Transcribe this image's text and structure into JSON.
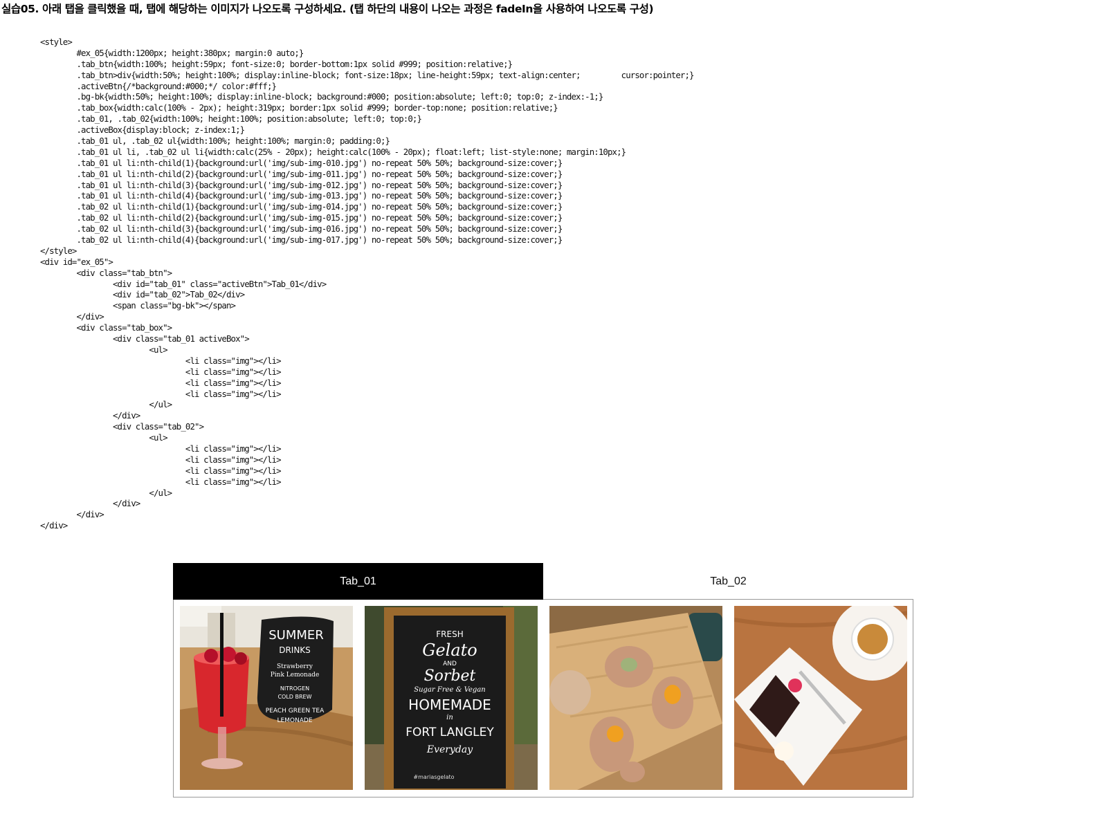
{
  "heading": "실습05. 아래 탭을 클릭했을 때, 탭에 해당하는 이미지가 나오도록 구성하세요. (탭 하단의 내용이 나오는 과정은 fadeIn을 사용하여 나오도록 구성)",
  "code_lines": [
    "<style>",
    "        #ex_05{width:1200px; height:380px; margin:0 auto;}",
    "        .tab_btn{width:100%; height:59px; font-size:0; border-bottom:1px solid #999; position:relative;}",
    "        .tab_btn>div{width:50%; height:100%; display:inline-block; font-size:18px; line-height:59px; text-align:center;         cursor:pointer;}",
    "        .activeBtn{/*background:#000;*/ color:#fff;}",
    "        .bg-bk{width:50%; height:100%; display:inline-block; background:#000; position:absolute; left:0; top:0; z-index:-1;}",
    "        .tab_box{width:calc(100% - 2px); height:319px; border:1px solid #999; border-top:none; position:relative;}",
    "        .tab_01, .tab_02{width:100%; height:100%; position:absolute; left:0; top:0;}",
    "        .activeBox{display:block; z-index:1;}",
    "        .tab_01 ul, .tab_02 ul{width:100%; height:100%; margin:0; padding:0;}",
    "        .tab_01 ul li, .tab_02 ul li{width:calc(25% - 20px); height:calc(100% - 20px); float:left; list-style:none; margin:10px;}",
    "        .tab_01 ul li:nth-child(1){background:url('img/sub-img-010.jpg') no-repeat 50% 50%; background-size:cover;}",
    "        .tab_01 ul li:nth-child(2){background:url('img/sub-img-011.jpg') no-repeat 50% 50%; background-size:cover;}",
    "        .tab_01 ul li:nth-child(3){background:url('img/sub-img-012.jpg') no-repeat 50% 50%; background-size:cover;}",
    "        .tab_01 ul li:nth-child(4){background:url('img/sub-img-013.jpg') no-repeat 50% 50%; background-size:cover;}",
    "        .tab_02 ul li:nth-child(1){background:url('img/sub-img-014.jpg') no-repeat 50% 50%; background-size:cover;}",
    "        .tab_02 ul li:nth-child(2){background:url('img/sub-img-015.jpg') no-repeat 50% 50%; background-size:cover;}",
    "        .tab_02 ul li:nth-child(3){background:url('img/sub-img-016.jpg') no-repeat 50% 50%; background-size:cover;}",
    "        .tab_02 ul li:nth-child(4){background:url('img/sub-img-017.jpg') no-repeat 50% 50%; background-size:cover;}",
    "</style>",
    "<div id=\"ex_05\">",
    "        <div class=\"tab_btn\">",
    "                <div id=\"tab_01\" class=\"activeBtn\">Tab_01</div>",
    "                <div id=\"tab_02\">Tab_02</div>",
    "                <span class=\"bg-bk\"></span>",
    "        </div>",
    "        <div class=\"tab_box\">",
    "                <div class=\"tab_01 activeBox\">",
    "                        <ul>",
    "                                <li class=\"img\"></li>",
    "                                <li class=\"img\"></li>",
    "                                <li class=\"img\"></li>",
    "                                <li class=\"img\"></li>",
    "                        </ul>",
    "                </div>",
    "                <div class=\"tab_02\">",
    "                        <ul>",
    "                                <li class=\"img\"></li>",
    "                                <li class=\"img\"></li>",
    "                                <li class=\"img\"></li>",
    "                                <li class=\"img\"></li>",
    "                        </ul>",
    "                </div>",
    "        </div>",
    "</div>"
  ],
  "tabs": [
    {
      "label": "Tab_01",
      "active": true
    },
    {
      "label": "Tab_02",
      "active": false
    }
  ],
  "active_tab_bg": "#000000",
  "border_color": "#999999",
  "images": [
    {
      "name": "summer-drinks-photo",
      "sign_lines": [
        "SUMMER",
        "DRINKS",
        "Strawberry",
        "Pink Lemonade",
        "NITROGEN",
        "COLD BREW",
        "PEACH GREEN TEA",
        "LEMONADE"
      ]
    },
    {
      "name": "gelato-sign-photo",
      "sign_lines": [
        "FRESH",
        "Gelato",
        "AND",
        "Sorbet",
        "Sugar Free & Vegan",
        "HOMEMADE",
        "in",
        "FORT LANGLEY",
        "Everyday",
        "#mariasgelato"
      ]
    },
    {
      "name": "pastries-photo"
    },
    {
      "name": "cake-coffee-photo"
    }
  ]
}
